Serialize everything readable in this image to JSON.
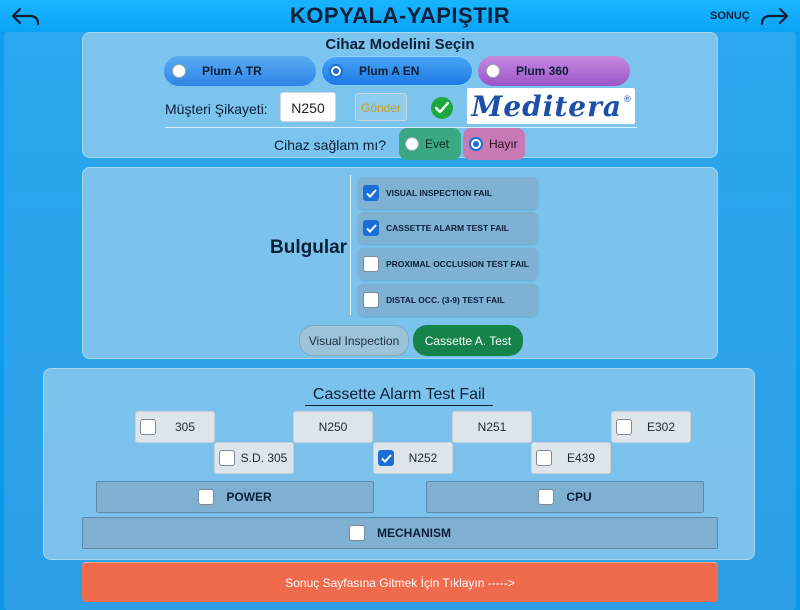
{
  "header": {
    "title": "KOPYALA-YAPIŞTIR",
    "next_label": "SONUÇ"
  },
  "device": {
    "title": "Cihaz Modelini Seçin",
    "models": [
      {
        "label": "Plum A TR",
        "selected": false
      },
      {
        "label": "Plum A EN",
        "selected": true
      },
      {
        "label": "Plum 360",
        "selected": false
      }
    ],
    "complaint_label": "Müşteri Şikayeti:",
    "complaint_value": "N250",
    "send_label": "Gönder",
    "logo_text": "Meditera",
    "healthy_label": "Cihaz sağlam mı?",
    "yes_label": "Evet",
    "no_label": "Hayır",
    "healthy_selected": "Hayır"
  },
  "findings": {
    "title": "Bulgular",
    "items": [
      {
        "label": "VISUAL INSPECTION FAIL",
        "checked": true
      },
      {
        "label": "CASSETTE ALARM TEST FAIL",
        "checked": true
      },
      {
        "label": "PROXIMAL OCCLUSION TEST FAIL",
        "checked": false
      },
      {
        "label": "DISTAL OCC. (3-9) TEST FAIL",
        "checked": false
      }
    ],
    "tabs": [
      {
        "label": "Visual Inspection",
        "active": false
      },
      {
        "label": "Cassette A. Test",
        "active": true
      }
    ]
  },
  "cassette": {
    "title": "Cassette Alarm Test Fail",
    "codes": [
      {
        "label": "305",
        "checked": false,
        "checkbox": true
      },
      {
        "label": "N250",
        "checked": false,
        "checkbox": false
      },
      {
        "label": "N251",
        "checked": false,
        "checkbox": false
      },
      {
        "label": "E302",
        "checked": false,
        "checkbox": true
      },
      {
        "label": "S.D. 305",
        "checked": false,
        "checkbox": true
      },
      {
        "label": "N252",
        "checked": true,
        "checkbox": true
      },
      {
        "label": "E439",
        "checked": false,
        "checkbox": true
      }
    ],
    "power_label": "POWER",
    "cpu_label": "CPU",
    "mechanism_label": "MECHANISM"
  },
  "footer": {
    "go_label": "Sonuç Sayfasına Gitmek İçin Tıklayın ----->"
  },
  "colors": {
    "background": "#0d9ef0",
    "accent_blue": "#1b6ed6",
    "green_check": "#1ba83c",
    "tab_active": "#16834a",
    "go_bar": "#f06a4e"
  }
}
